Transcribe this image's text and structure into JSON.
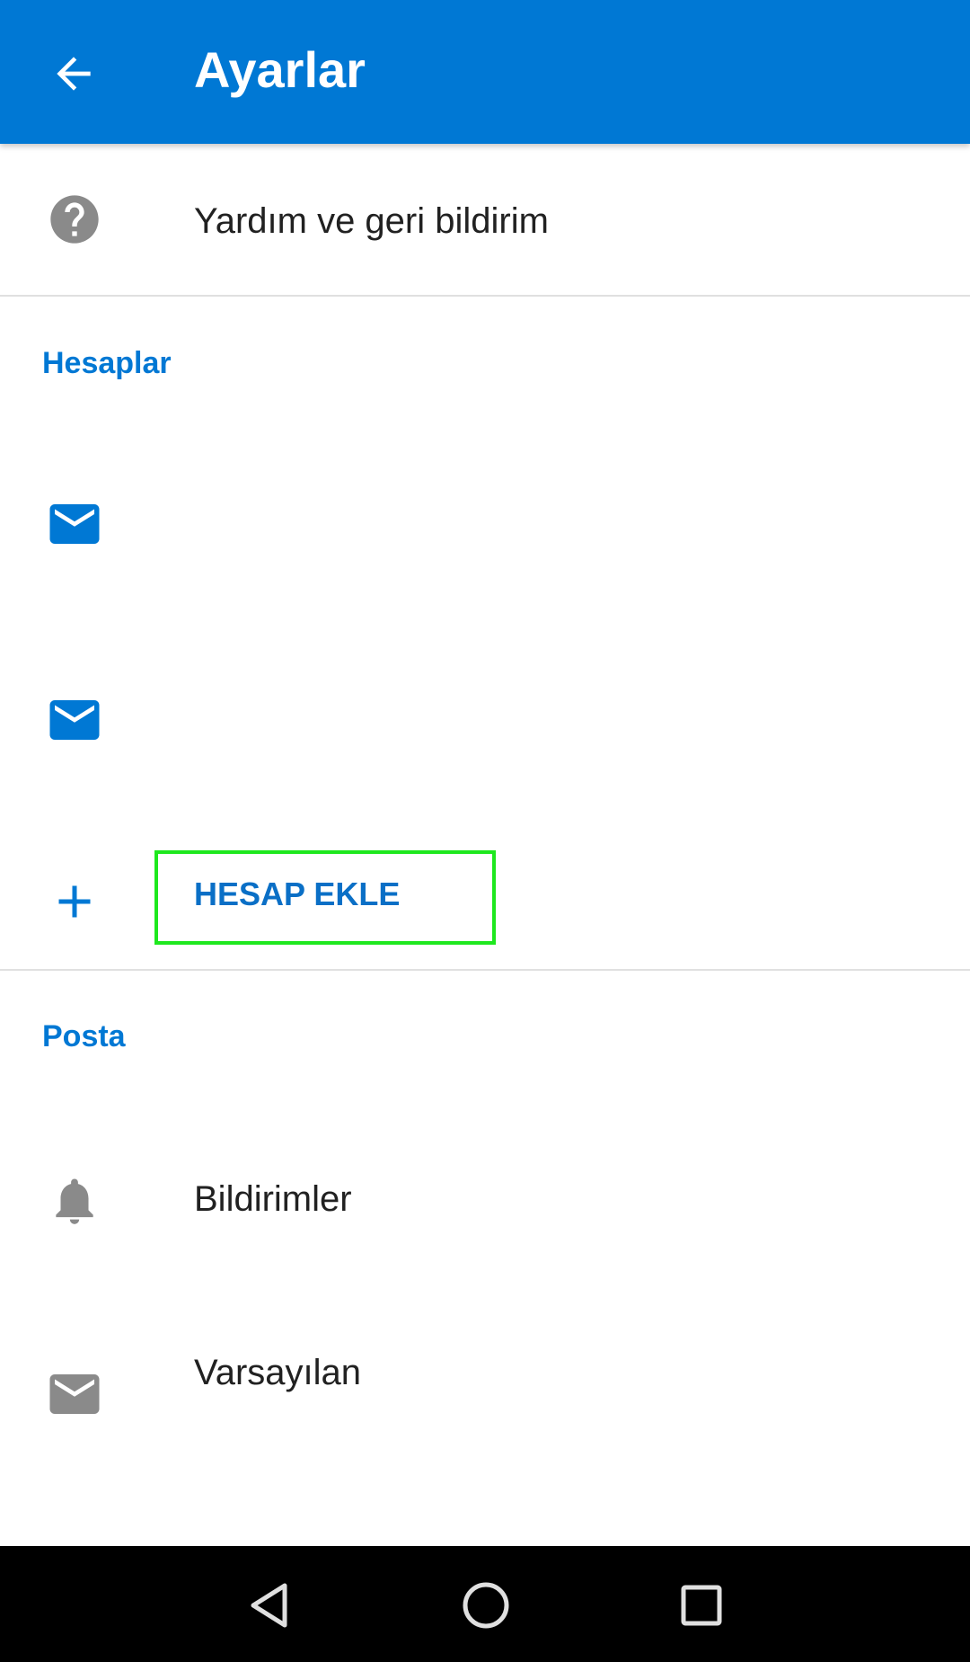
{
  "app_bar": {
    "title": "Ayarlar",
    "back_icon": "arrow-left-icon",
    "background": "#0078d4"
  },
  "top_items": [
    {
      "label": "Yardım ve geri bildirim",
      "icon": "help-circle-icon"
    }
  ],
  "sections": {
    "accounts": {
      "header": "Hesaplar",
      "accounts": [
        {
          "icon": "mail-icon"
        },
        {
          "icon": "mail-icon"
        }
      ],
      "add_account_label": "HESAP EKLE",
      "add_icon": "plus-icon"
    },
    "mail": {
      "header": "Posta",
      "items": [
        {
          "label": "Bildirimler",
          "icon": "bell-icon"
        },
        {
          "label": "Varsayılan",
          "icon": "mail-icon"
        }
      ]
    }
  },
  "nav_bar": {
    "buttons": [
      "back-triangle-icon",
      "home-circle-icon",
      "recents-square-icon"
    ]
  },
  "colors": {
    "accent": "#0078d4",
    "icon_gray": "#8a8a8a",
    "highlight": "#1ee81e"
  }
}
